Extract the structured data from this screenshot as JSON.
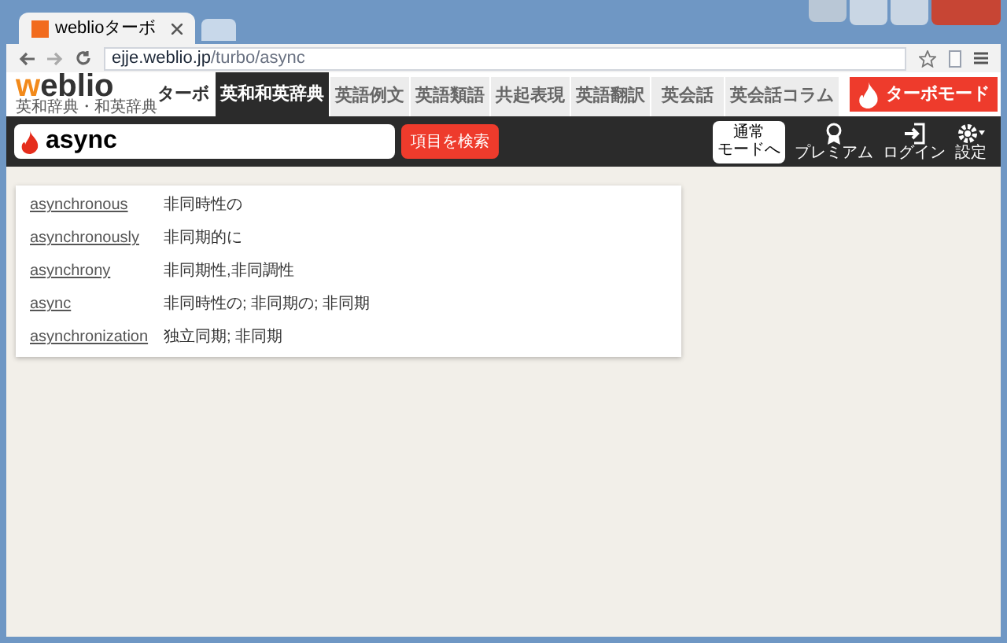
{
  "browser": {
    "tab_title": "weblioターボ",
    "url_host": "ejje.weblio.jp",
    "url_path": "/turbo/async"
  },
  "site": {
    "logo": "weblio",
    "logo_sub": "英和辞典・和英辞典",
    "turbo_label": "ターボ",
    "nav": [
      {
        "label": "英和和英辞典",
        "selected": true
      },
      {
        "label": "英語例文",
        "selected": false
      },
      {
        "label": "英語類語",
        "selected": false
      },
      {
        "label": "共起表現",
        "selected": false
      },
      {
        "label": "英語翻訳",
        "selected": false
      },
      {
        "label": "英会話",
        "selected": false
      },
      {
        "label": "英会話コラム",
        "selected": false
      }
    ],
    "turbo_mode_button": "ターボモード"
  },
  "search": {
    "value": "async",
    "button": "項目を検索"
  },
  "toolbar": [
    {
      "kind": "normal",
      "label_top": "通常",
      "label": "モードへ"
    },
    {
      "kind": "premium",
      "label": "プレミアム"
    },
    {
      "kind": "login",
      "label": "ログイン"
    },
    {
      "kind": "settings",
      "label": "設定"
    }
  ],
  "results": [
    {
      "word": "asynchronous",
      "meaning": "非同時性の"
    },
    {
      "word": "asynchronously",
      "meaning": "非同期的に"
    },
    {
      "word": "asynchrony",
      "meaning": "非同期性,非同調性"
    },
    {
      "word": "async",
      "meaning": "非同時性の; 非同期の; 非同期"
    },
    {
      "word": "asynchronization",
      "meaning": "独立同期; 非同期"
    }
  ]
}
